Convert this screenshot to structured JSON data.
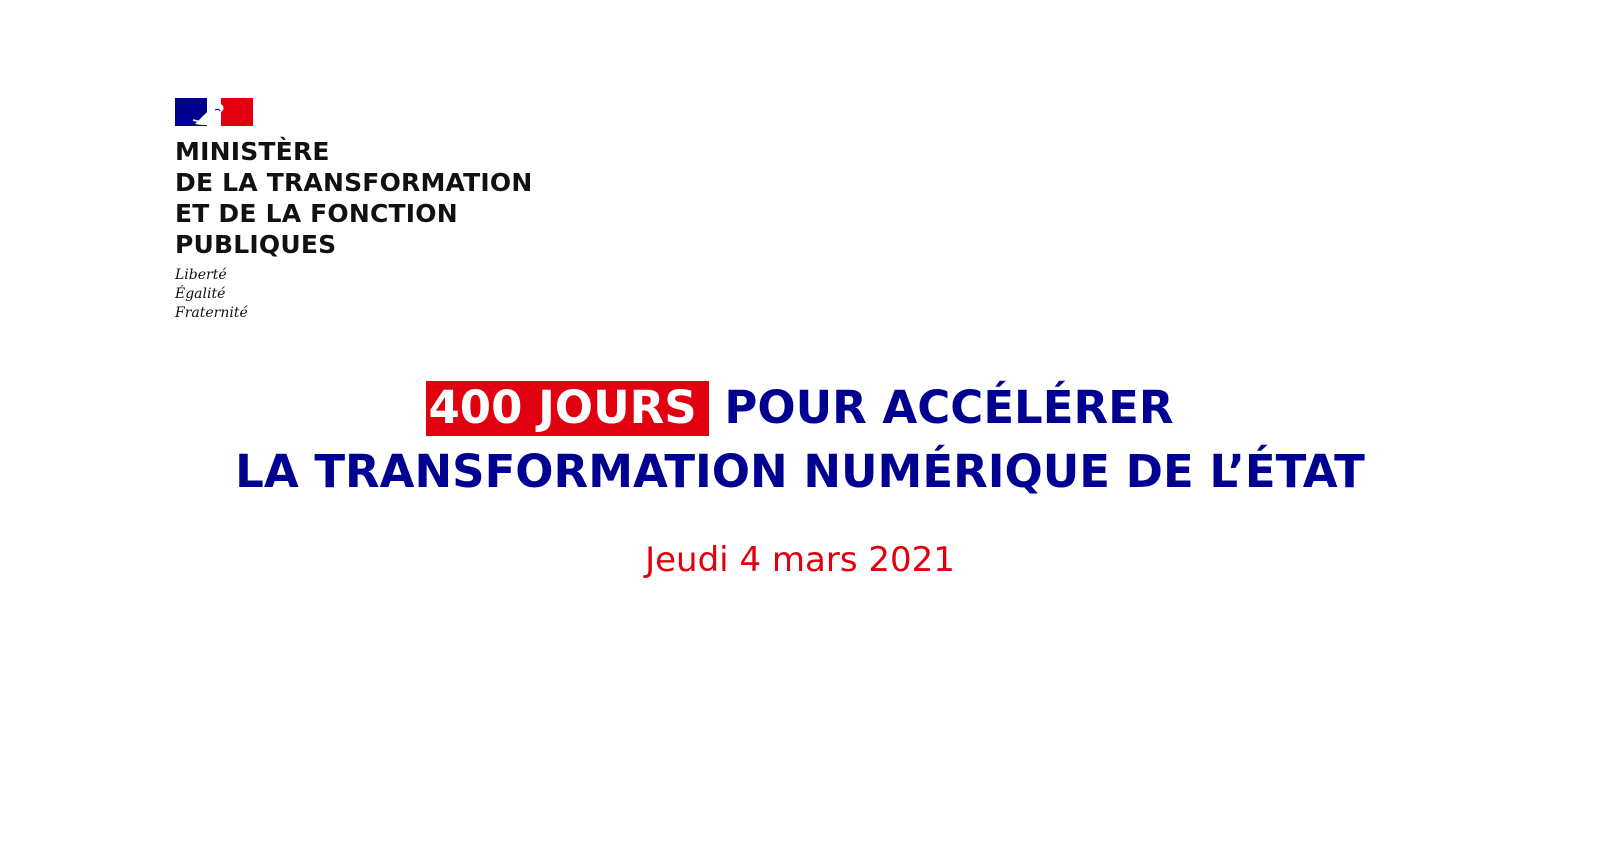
{
  "colors": {
    "blue": "#000091",
    "red": "#e1000f",
    "text": "#111111"
  },
  "logo": {
    "icon": "marianne-flag-icon",
    "ministry_lines": [
      "MINISTÈRE",
      "DE LA TRANSFORMATION",
      "ET DE LA FONCTION",
      "PUBLIQUES"
    ],
    "motto": [
      "Liberté",
      "Égalité",
      "Fraternité"
    ]
  },
  "title": {
    "highlight": "400 JOURS",
    "line1_rest": "POUR ACCÉLÉRER",
    "line2": "LA TRANSFORMATION NUMÉRIQUE DE L’ÉTAT"
  },
  "date": "Jeudi 4 mars 2021"
}
